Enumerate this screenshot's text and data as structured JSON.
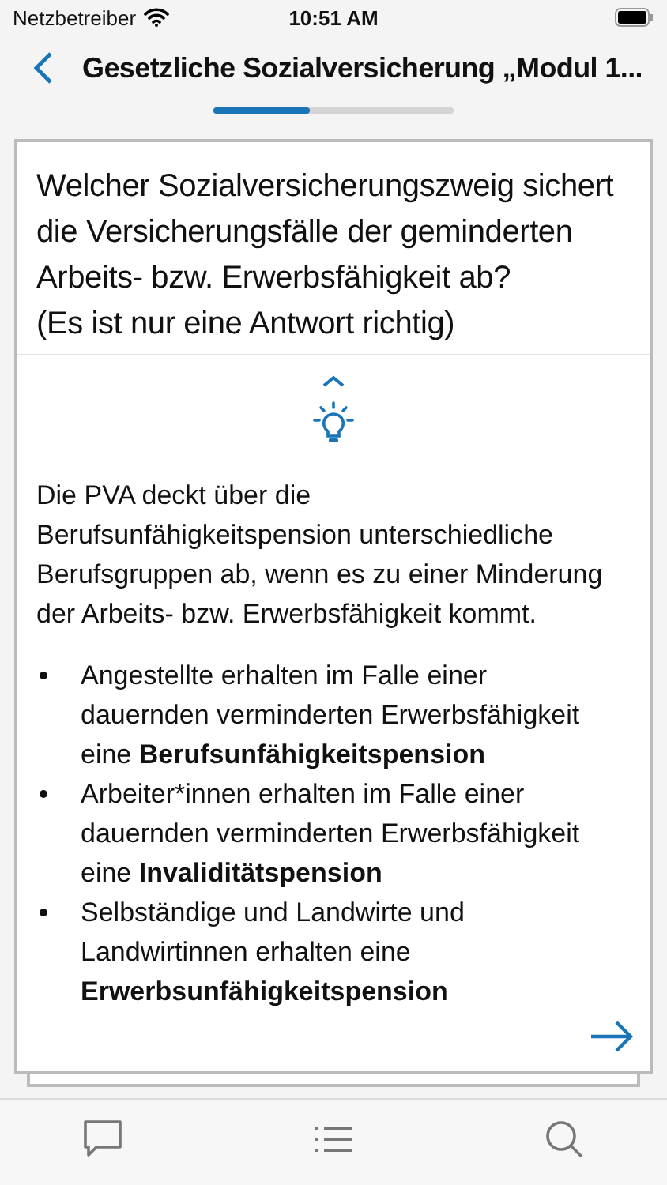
{
  "status_bar": {
    "carrier": "Netzbetreiber",
    "time": "10:51 AM"
  },
  "header": {
    "title": "Gesetzliche Sozialversicherung  „Modul 1..."
  },
  "progress": {
    "level": 0.4
  },
  "question": {
    "text": "Welcher Sozialversicherungszweig sichert die Versicherungsfälle der geminderten Arbeits- bzw. Erwerbsfähigkeit ab?",
    "hint": "(Es ist nur eine Antwort richtig)"
  },
  "explanation": {
    "intro": "Die PVA deckt über die Berufsunfähigkeitspension unterschiedliche Berufsgruppen ab, wenn es zu einer Minderung der Arbeits- bzw. Erwerbsfähigkeit kommt.",
    "bullets": [
      "Angestellte erhalten im Falle einer dauernden verminderten Erwerbsfähigkeit eine **Berufsunfähigkeitspension**",
      "Arbeiter*innen erhalten im Falle einer dauernden verminderten Erwerbsfähigkeit eine **Invaliditätspension**",
      "Selbständige und Landwirte und Landwirtinnen erhalten eine **Erwerbsunfähigkeitspension**"
    ]
  }
}
